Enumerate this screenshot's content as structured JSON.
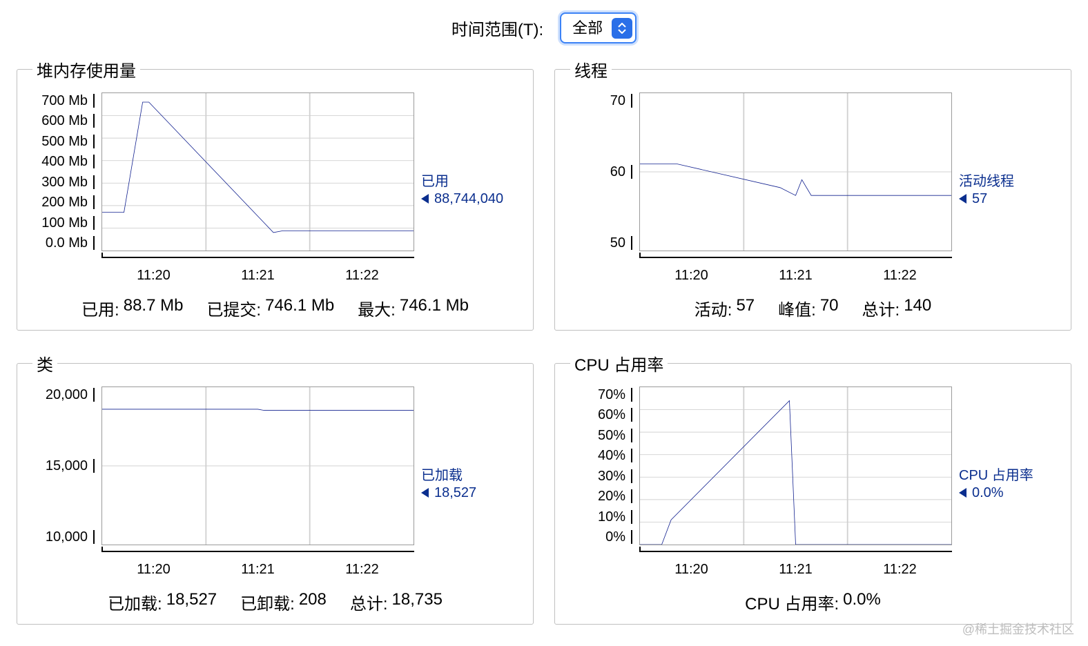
{
  "header": {
    "time_range_label": "时间范围(T):",
    "time_range_value": "全部"
  },
  "panels": {
    "heap": {
      "title": "堆内存使用量",
      "legend_name": "已用",
      "legend_value": "88,744,040",
      "stats": {
        "used_label": "已用:",
        "used_value": "88.7 Mb",
        "committed_label": "已提交:",
        "committed_value": "746.1 Mb",
        "max_label": "最大:",
        "max_value": "746.1 Mb"
      }
    },
    "threads": {
      "title": "线程",
      "legend_name": "活动线程",
      "legend_value": "57",
      "stats": {
        "live_label": "活动:",
        "live_value": "57",
        "peak_label": "峰值:",
        "peak_value": "70",
        "total_label": "总计:",
        "total_value": "140"
      }
    },
    "classes": {
      "title": "类",
      "legend_name": "已加载",
      "legend_value": "18,527",
      "stats": {
        "loaded_label": "已加载:",
        "loaded_value": "18,527",
        "unloaded_label": "已卸载:",
        "unloaded_value": "208",
        "total_label": "总计:",
        "total_value": "18,735"
      }
    },
    "cpu": {
      "title": "CPU 占用率",
      "legend_name": "CPU 占用率",
      "legend_value": "0.0%",
      "stats": {
        "usage_label": "CPU 占用率:",
        "usage_value": "0.0%"
      }
    }
  },
  "x_ticks": [
    "11:20",
    "11:21",
    "11:22"
  ],
  "watermark": "@稀土掘金技术社区",
  "chart_data": [
    {
      "type": "line",
      "title": "堆内存使用量",
      "xlabel": "",
      "ylabel": "Mb",
      "ylim": [
        0,
        700
      ],
      "x_labels": [
        "11:20",
        "11:21",
        "11:22"
      ],
      "y_ticks": [
        "700 Mb",
        "600 Mb",
        "500 Mb",
        "400 Mb",
        "300 Mb",
        "200 Mb",
        "100 Mb",
        "0.0 Mb"
      ],
      "series": [
        {
          "name": "已用",
          "x": [
            0,
            0.07,
            0.13,
            0.15,
            0.55,
            0.58,
            1.0
          ],
          "y": [
            170,
            170,
            660,
            660,
            80,
            88,
            88
          ]
        }
      ]
    },
    {
      "type": "line",
      "title": "线程",
      "xlabel": "",
      "ylabel": "",
      "ylim": [
        50,
        70
      ],
      "x_labels": [
        "11:20",
        "11:21",
        "11:22"
      ],
      "y_ticks": [
        "70",
        "60",
        "50"
      ],
      "series": [
        {
          "name": "活动线程",
          "x": [
            0,
            0.12,
            0.45,
            0.5,
            0.52,
            0.55,
            1.0
          ],
          "y": [
            61,
            61,
            58,
            57,
            59,
            57,
            57
          ]
        }
      ]
    },
    {
      "type": "line",
      "title": "类",
      "xlabel": "",
      "ylabel": "",
      "ylim": [
        10000,
        20000
      ],
      "x_labels": [
        "11:20",
        "11:21",
        "11:22"
      ],
      "y_ticks": [
        "20,000",
        "15,000",
        "10,000"
      ],
      "series": [
        {
          "name": "已加载",
          "x": [
            0,
            0.5,
            0.52,
            1.0
          ],
          "y": [
            18600,
            18600,
            18527,
            18527
          ]
        }
      ]
    },
    {
      "type": "line",
      "title": "CPU 占用率",
      "xlabel": "",
      "ylabel": "%",
      "ylim": [
        0,
        70
      ],
      "x_labels": [
        "11:20",
        "11:21",
        "11:22"
      ],
      "y_ticks": [
        "70%",
        "60%",
        "50%",
        "40%",
        "30%",
        "20%",
        "10%",
        "0%"
      ],
      "series": [
        {
          "name": "CPU 占用率",
          "x": [
            0,
            0.07,
            0.1,
            0.48,
            0.5,
            1.0
          ],
          "y": [
            0,
            0,
            11,
            64,
            0,
            0
          ]
        }
      ]
    }
  ]
}
